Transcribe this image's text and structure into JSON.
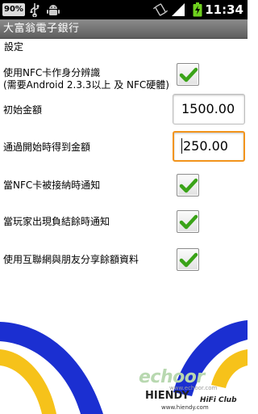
{
  "status_bar": {
    "battery_percent": "90%",
    "time": "11:34",
    "icons": [
      "usb-icon",
      "android-debug-icon",
      "vibrate-icon",
      "signal-icon",
      "battery-charging-icon"
    ]
  },
  "app": {
    "title": "大富翁電子銀行",
    "section_label": "設定"
  },
  "settings": {
    "nfc_identity": {
      "label": "使用NFC卡作身分辨識",
      "sublabel": "(需要Android 2.3.3以上 及 NFC硬體)",
      "checked": true
    },
    "initial_amount": {
      "label": "初始金額",
      "value": "1500.00"
    },
    "pass_go_amount": {
      "label": "通過開始時得到金額",
      "value": "250.00"
    },
    "notify_nfc": {
      "label": "當NFC卡被接納時通知",
      "checked": true
    },
    "notify_negative": {
      "label": "當玩家出現負結餘時通知",
      "checked": true
    },
    "share_online": {
      "label": "使用互聯網與朋友分享餘額資料",
      "checked": true
    }
  },
  "watermark": {
    "brand": "echoor",
    "url_top": "www.echoor.com",
    "name": "HIENDY",
    "club": "HiFi Club",
    "url_bottom": "www.hiendy.com"
  },
  "colors": {
    "status_bar_bg": "#000000",
    "title_bar_bg": "#6e6e6e",
    "focus_border": "#f2941c",
    "check_green": "#3aa318",
    "decor_blue": "#1b2fd1",
    "decor_yellow": "#f6c21a"
  }
}
